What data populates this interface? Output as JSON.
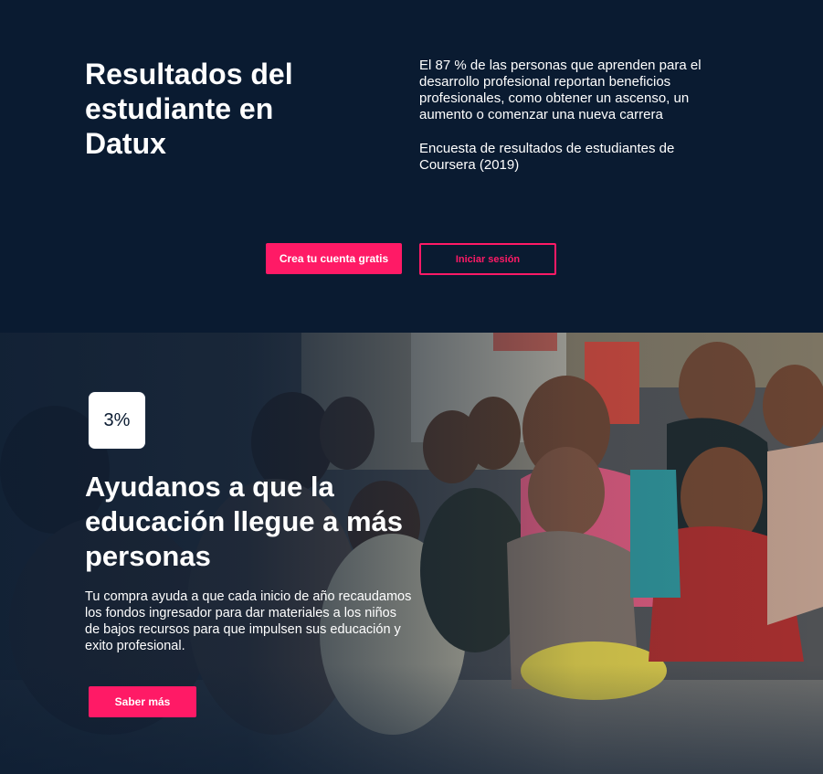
{
  "hero": {
    "title": "Resultados del estudiante en Datux",
    "stat_text": "El 87 % de las personas que aprenden para el desarrollo profesional reportan beneficios profesionales, como obtener un ascenso, un aumento o comenzar una nueva carrera",
    "source_text": "Encuesta de resultados de estudiantes de Coursera (2019)",
    "create_account_label": "Crea tu cuenta gratis",
    "login_label": "Iniciar sesión"
  },
  "donation": {
    "badge": "3%",
    "title": "Ayudanos a que la educación llegue a más personas",
    "description": "Tu compra ayuda a que cada inicio de año recaudamos los fondos ingresador para dar materiales a los niños de bajos recursos para que impulsen sus educación y exito profesional.",
    "learn_more_label": "Saber más",
    "photo_subject": "children-sitting-on-floor"
  },
  "colors": {
    "navy": "#0a1b31",
    "accent": "#ff1a66",
    "white": "#ffffff"
  }
}
